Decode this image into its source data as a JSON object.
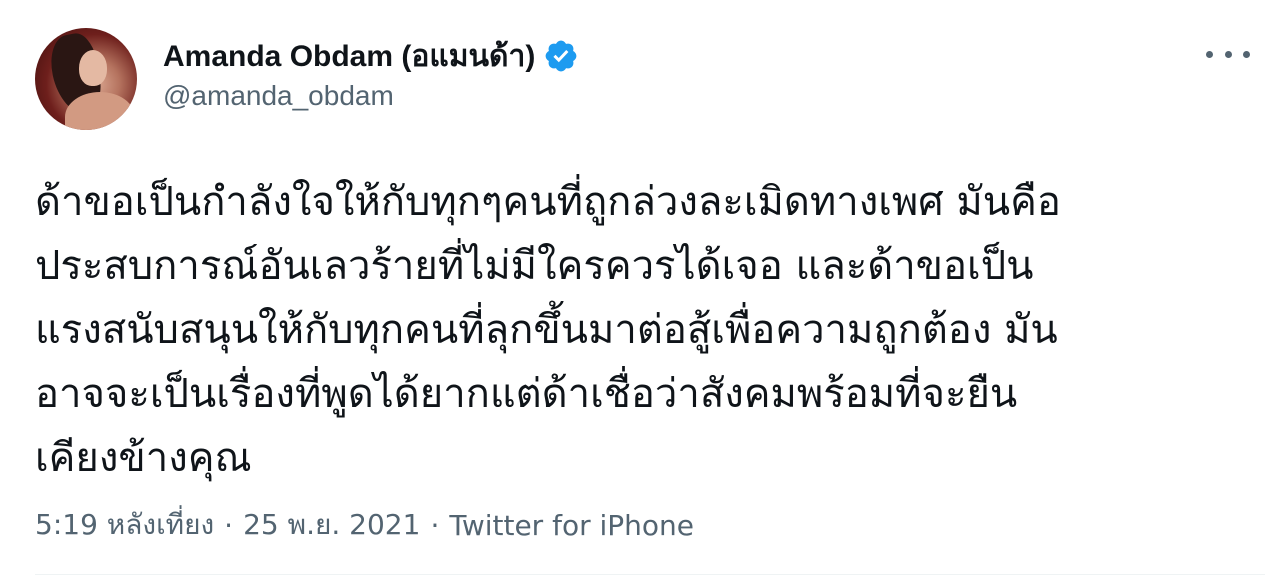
{
  "author": {
    "display_name": "Amanda Obdam (อแมนด้า)",
    "handle": "@amanda_obdam",
    "verified_icon": "verified-badge-icon",
    "avatar_icon": "profile-photo"
  },
  "more_icon": "more-options-icon",
  "tweet": {
    "lines": [
      "ด้าขอเป็นกำลังใจให้กับทุกๆคนที่ถูกล่วงละเมิดทางเพศ มันคือ",
      "ประสบการณ์อันเลวร้ายที่ไม่มีใครควรได้เจอ และด้าขอเป็น",
      "แรงสนับสนุนให้กับทุกคนที่ลุกขึ้นมาต่อสู้เพื่อความถูกต้อง มัน",
      "อาจจะเป็นเรื่องที่พูดได้ยากแต่ด้าเชื่อว่าสังคมพร้อมที่จะยืน",
      "เคียงข้างคุณ"
    ]
  },
  "meta": {
    "time": "5:19 หลังเที่ยง",
    "separator": "·",
    "date": "25 พ.ย. 2021",
    "source": "Twitter for iPhone"
  },
  "colors": {
    "text_primary": "#0f1419",
    "text_secondary": "#536471",
    "verified_blue": "#1d9bf0"
  }
}
